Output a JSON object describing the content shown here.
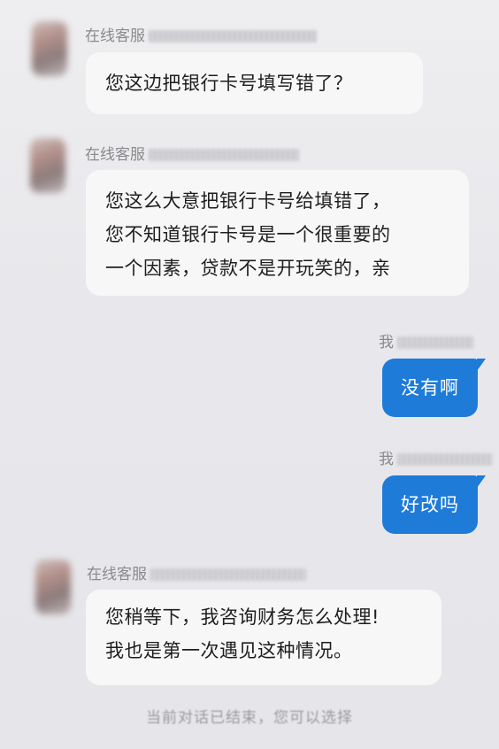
{
  "messages": [
    {
      "sender": "在线客服",
      "lines": [
        "您这边把银行卡号填写错了？"
      ]
    },
    {
      "sender": "在线客服",
      "lines": [
        "您这么大意把银行卡号给填错了，",
        "您不知道银行卡号是一个很重要的",
        "一个因素，贷款不是开玩笑的，亲"
      ]
    },
    {
      "sender": "我",
      "text": "没有啊"
    },
    {
      "sender": "我",
      "text": "好改吗"
    },
    {
      "sender": "在线客服",
      "lines": [
        "您稍等下，我咨询财务怎么处理!",
        "我也是第一次遇见这种情况。"
      ]
    }
  ],
  "footer": "当前对话已结束，您可以选择",
  "colors": {
    "background": "#e8e8ec",
    "incoming_bubble": "#f7f7f8",
    "outgoing_bubble": "#1e7bd8"
  }
}
